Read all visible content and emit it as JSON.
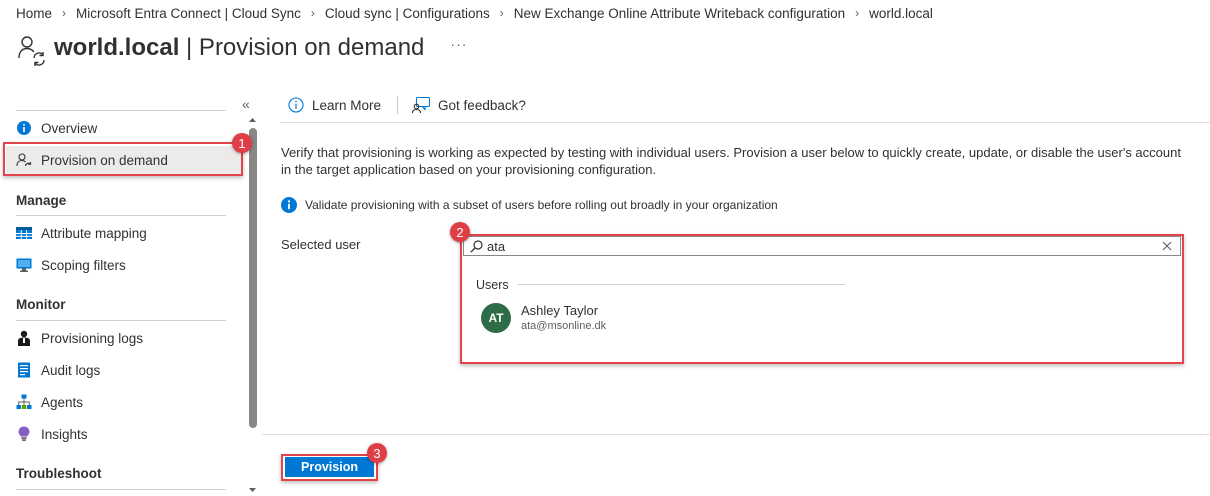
{
  "breadcrumb": [
    "Home",
    "Microsoft Entra Connect | Cloud Sync",
    "Cloud sync | Configurations",
    "New Exchange Online Attribute Writeback configuration",
    "world.local"
  ],
  "header": {
    "title_bold": "world.local",
    "title_rest": " | Provision on demand",
    "more": "···"
  },
  "sidebar": {
    "collapse": "«",
    "top_items": [
      {
        "label": "Overview",
        "icon": "info-icon"
      },
      {
        "label": "Provision on demand",
        "icon": "user-sync-icon",
        "selected": true
      }
    ],
    "sections": [
      {
        "title": "Manage",
        "items": [
          {
            "label": "Attribute mapping",
            "icon": "table-icon"
          },
          {
            "label": "Scoping filters",
            "icon": "monitor-icon"
          }
        ]
      },
      {
        "title": "Monitor",
        "items": [
          {
            "label": "Provisioning logs",
            "icon": "person-icon"
          },
          {
            "label": "Audit logs",
            "icon": "log-icon"
          },
          {
            "label": "Agents",
            "icon": "network-icon"
          },
          {
            "label": "Insights",
            "icon": "lightbulb-icon"
          }
        ]
      },
      {
        "title": "Troubleshoot",
        "items": []
      }
    ]
  },
  "toolbar": {
    "learn_more": "Learn More",
    "feedback": "Got feedback?"
  },
  "main": {
    "description": "Verify that provisioning is working as expected by testing with individual users. Provision a user below to quickly create, update, or disable the user's account in the target application based on your provisioning configuration.",
    "info": "Validate provisioning with a subset of users before rolling out broadly in your organization",
    "selected_user_label": "Selected user",
    "search_value": "ata",
    "dropdown": {
      "header": "Users",
      "users": [
        {
          "initials": "AT",
          "name": "Ashley Taylor",
          "email": "ata@msonline.dk"
        }
      ]
    },
    "provision_label": "Provision"
  },
  "annotations": {
    "badge1": "1",
    "badge2": "2",
    "badge3": "3"
  },
  "colors": {
    "accent": "#0078d4",
    "highlight": "#e4434b",
    "avatar": "#2e6b47"
  }
}
